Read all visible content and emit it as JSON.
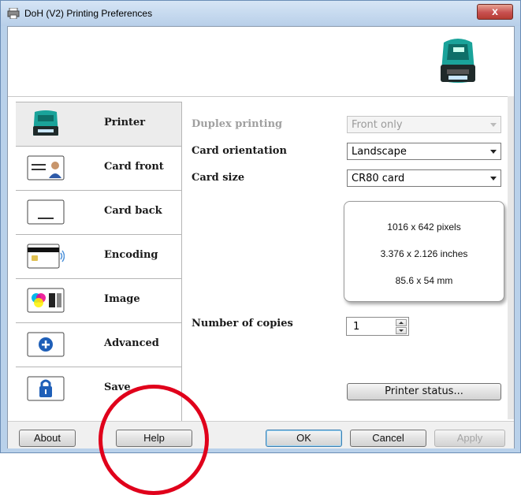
{
  "window": {
    "title": "DoH (V2) Printing Preferences",
    "close_glyph": "x"
  },
  "sidebar": {
    "items": [
      {
        "label": "Printer",
        "icon": "printer-icon"
      },
      {
        "label": "Card front",
        "icon": "card-front-icon"
      },
      {
        "label": "Card back",
        "icon": "card-back-icon"
      },
      {
        "label": "Encoding",
        "icon": "encoding-icon"
      },
      {
        "label": "Image",
        "icon": "image-icon"
      },
      {
        "label": "Advanced",
        "icon": "advanced-icon"
      },
      {
        "label": "Save",
        "icon": "lock-icon"
      }
    ]
  },
  "form": {
    "duplex": {
      "label": "Duplex printing",
      "value": "Front only"
    },
    "orientation": {
      "label": "Card orientation",
      "value": "Landscape"
    },
    "size": {
      "label": "Card size",
      "value": "CR80 card"
    },
    "card_info": {
      "pixels": "1016 x 642 pixels",
      "inches": "3.376 x 2.126 inches",
      "mm": "85.6 x 54 mm"
    },
    "copies": {
      "label": "Number of copies",
      "value": "1"
    },
    "printer_status": "Printer status..."
  },
  "footer": {
    "about": "About",
    "help": "Help",
    "ok": "OK",
    "cancel": "Cancel",
    "apply": "Apply"
  },
  "colors": {
    "accent": "#1aa39a",
    "highlight_circle": "#e0001b"
  }
}
